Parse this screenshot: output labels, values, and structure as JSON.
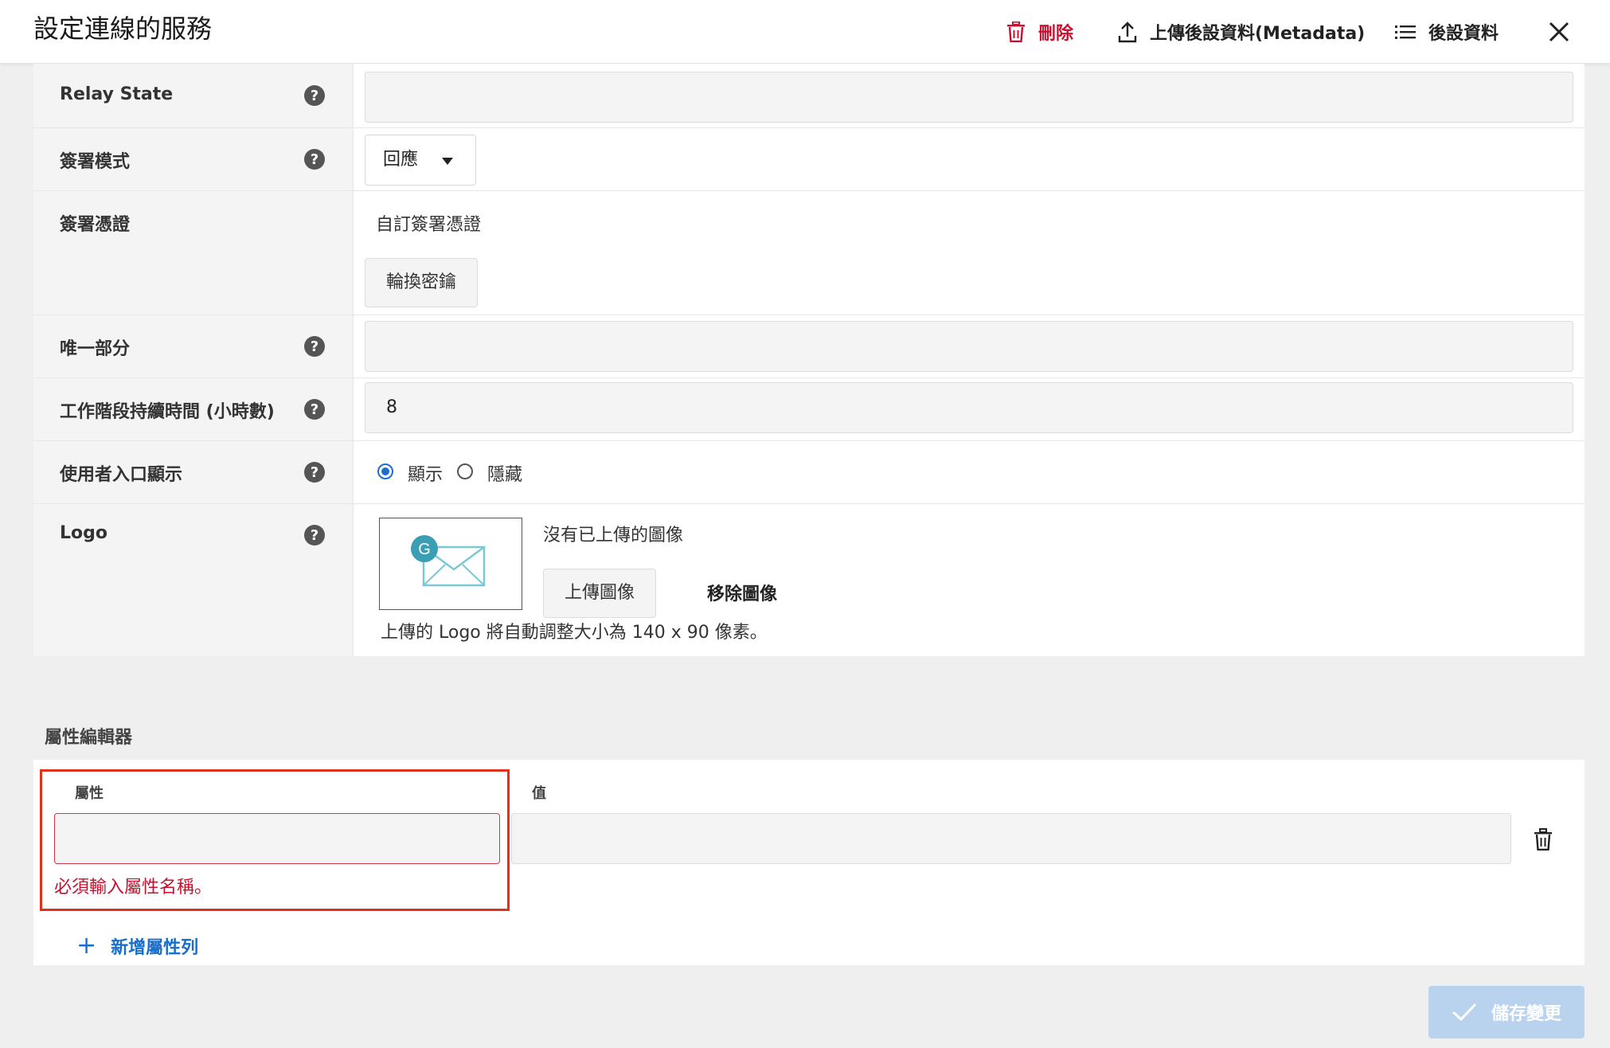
{
  "header": {
    "title": "設定連線的服務",
    "delete_label": "刪除",
    "upload_metadata_label": "上傳後設資料(Metadata)",
    "metadata_label": "後設資料"
  },
  "form": {
    "relay_state": {
      "label": "Relay State",
      "value": ""
    },
    "signing_mode": {
      "label": "簽署模式",
      "selected": "回應"
    },
    "signing_cert": {
      "label": "簽署憑證",
      "value_text": "自訂簽署憑證",
      "rotate_button": "輪換密鑰"
    },
    "unique_part": {
      "label": "唯一部分",
      "value": ""
    },
    "session_duration": {
      "label": "工作階段持續時間 (小時數)",
      "value": "8"
    },
    "user_portal_display": {
      "label": "使用者入口顯示",
      "options": [
        "顯示",
        "隱藏"
      ],
      "selected": "顯示"
    },
    "logo": {
      "label": "Logo",
      "no_image_text": "沒有已上傳的圖像",
      "upload_button": "上傳圖像",
      "remove_button": "移除圖像",
      "hint": "上傳的 Logo 將自動調整大小為 140 x 90 像素。",
      "placeholder_letter": "G"
    }
  },
  "attribute_editor": {
    "title": "屬性編輯器",
    "col_attribute": "屬性",
    "col_value": "值",
    "rows": [
      {
        "attribute": "",
        "value": ""
      }
    ],
    "error": "必須輸入屬性名稱。",
    "add_row_label": "新增屬性列"
  },
  "footer": {
    "save_label": "儲存變更"
  },
  "colors": {
    "danger": "#c8102e",
    "accent": "#1a6fcc",
    "highlight": "#e0311f",
    "save_disabled": "#b9d3ee"
  }
}
